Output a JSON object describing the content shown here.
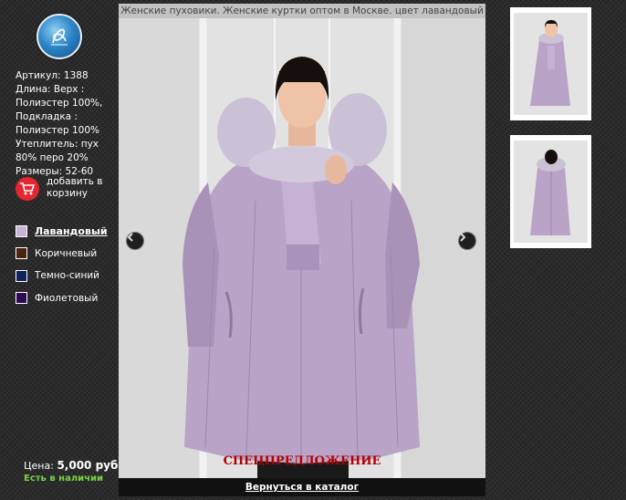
{
  "viewer": {
    "title": "Женские пуховики. Женские куртки оптом в Москве. цвет лавандовый",
    "special_offer": "СПЕЦПРЕДЛОЖЕНИЕ",
    "back_link": "Вернуться в каталог"
  },
  "product": {
    "details": [
      "Артикул: 1388",
      "Длина: Верх :",
      "Полиэстер 100%,",
      "Подкладка :",
      "Полиэстер 100%",
      "Утеплитель: пух",
      "80% перо 20%",
      "Размеры: 52-60"
    ],
    "add_to_cart": "добавить в корзину",
    "price_label": "Цена:",
    "price_value": "5,000 руб.",
    "stock": "Есть в наличии"
  },
  "colors": [
    {
      "label": "Лавандовый",
      "hex": "#c7b3d6",
      "active": true
    },
    {
      "label": "Коричневый",
      "hex": "#4a2410",
      "active": false
    },
    {
      "label": "Темно-синий",
      "hex": "#10245a",
      "active": false
    },
    {
      "label": "Фиолетовый",
      "hex": "#2e0a54",
      "active": false
    }
  ],
  "icons": {
    "logo": "logo-emblem",
    "cart": "cart-icon",
    "prev": "arrow-left-icon",
    "next": "arrow-right-icon"
  },
  "theme": {
    "coat": "#b8a3c6",
    "fur": "#cfc6d8",
    "stock_color": "#78d04a",
    "special_color": "#b30000",
    "cart_color": "#e3262f"
  }
}
